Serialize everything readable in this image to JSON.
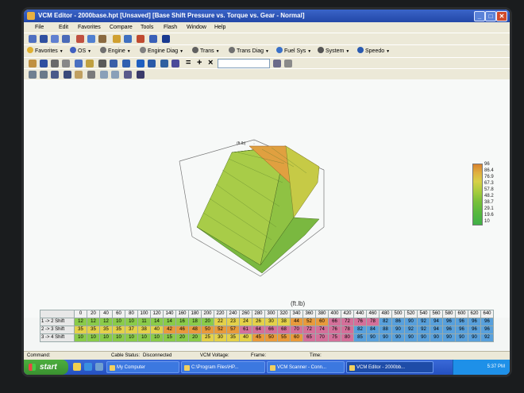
{
  "window": {
    "title": "VCM Editor - 2000base.hpt  [Unsaved]  [Base Shift Pressure vs. Torque vs. Gear - Normal]"
  },
  "menu": [
    "File",
    "Edit",
    "Favorites",
    "Compare",
    "Tools",
    "Flash",
    "Window",
    "Help"
  ],
  "nav_toolbar": {
    "favorites": "Favorites",
    "os": "OS",
    "engine": "Engine",
    "engine_diag": "Engine Diag",
    "trans": "Trans",
    "trans_diag": "Trans Diag",
    "fuel_sys": "Fuel Sys",
    "system": "System",
    "speedo": "Speedo"
  },
  "edit_toolbar": {
    "op_equals": "=",
    "op_plus": "+",
    "op_times": "×"
  },
  "chart": {
    "z_axis_label": "(ft.lb)",
    "x_axis_title": "(ft.lb)",
    "colorbar_labels": [
      "96",
      "86.4",
      "76.9",
      "67.3",
      "57.8",
      "48.2",
      "38.7",
      "29.1",
      "19.6",
      "10"
    ]
  },
  "table": {
    "columns": [
      "0",
      "20",
      "40",
      "60",
      "80",
      "100",
      "120",
      "140",
      "160",
      "180",
      "200",
      "220",
      "240",
      "260",
      "280",
      "300",
      "320",
      "340",
      "360",
      "380",
      "400",
      "420",
      "440",
      "460",
      "480",
      "500",
      "520",
      "540",
      "560",
      "580",
      "600",
      "620",
      "640"
    ],
    "rows": [
      {
        "label": "1 -> 2 Shift",
        "cells": [
          "12",
          "12",
          "12",
          "10",
          "10",
          "11",
          "14",
          "14",
          "16",
          "18",
          "20",
          "22",
          "23",
          "24",
          "26",
          "30",
          "38",
          "44",
          "52",
          "60",
          "66",
          "72",
          "76",
          "78",
          "82",
          "86",
          "90",
          "92",
          "94",
          "96",
          "96",
          "96",
          "96"
        ]
      },
      {
        "label": "2 -> 3 Shift",
        "cells": [
          "35",
          "35",
          "35",
          "35",
          "37",
          "38",
          "40",
          "42",
          "46",
          "48",
          "50",
          "52",
          "57",
          "61",
          "64",
          "66",
          "68",
          "70",
          "72",
          "74",
          "76",
          "78",
          "82",
          "84",
          "88",
          "90",
          "92",
          "92",
          "94",
          "96",
          "96",
          "96",
          "96"
        ]
      },
      {
        "label": "3 -> 4 Shift",
        "cells": [
          "10",
          "10",
          "10",
          "10",
          "10",
          "10",
          "10",
          "15",
          "20",
          "20",
          "25",
          "30",
          "35",
          "40",
          "45",
          "50",
          "55",
          "60",
          "65",
          "70",
          "75",
          "80",
          "85",
          "90",
          "90",
          "90",
          "90",
          "90",
          "90",
          "90",
          "90",
          "90",
          "92"
        ]
      }
    ]
  },
  "status": {
    "command": "Command:",
    "cable_status": "Cable Status:",
    "cable_value": "Disconnected",
    "vcm_voltage": "VCM Voltage:",
    "frame": "Frame:",
    "time": "Time:"
  },
  "taskbar": {
    "start": "start",
    "tasks": [
      "My Computer",
      "C:\\Program Files\\HP...",
      "VCM Scanner - Conn...",
      "VCM Editor - 2000bb..."
    ],
    "clock": "5:37 PM"
  }
}
